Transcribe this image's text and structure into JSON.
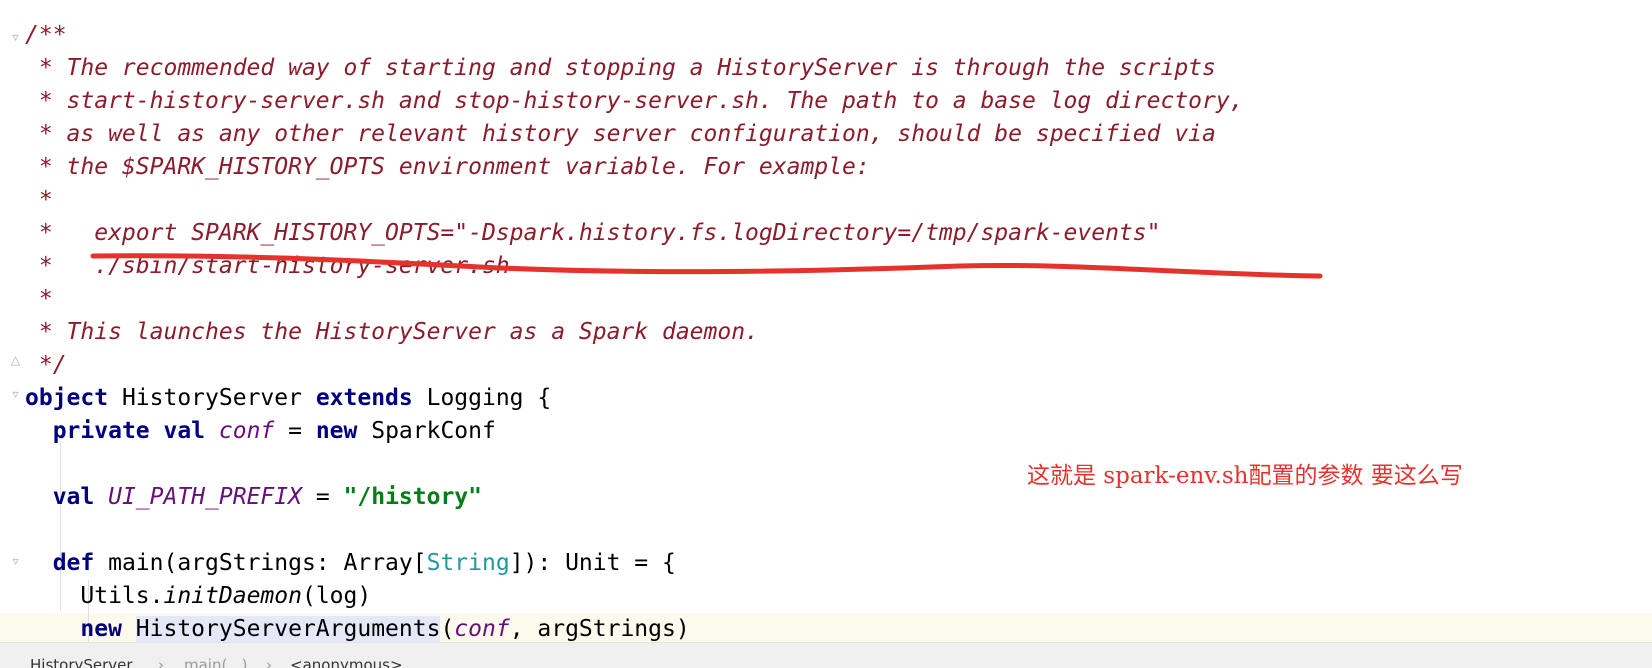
{
  "editor": {
    "lines": [
      {
        "tokens": [
          {
            "t": "/**",
            "c": "comment"
          }
        ]
      },
      {
        "tokens": [
          {
            "t": " * The recommended way of starting and stopping a HistoryServer is through the scripts",
            "c": "comment"
          }
        ]
      },
      {
        "tokens": [
          {
            "t": " * start-history-server.sh and stop-history-server.sh. The path to a base log directory,",
            "c": "comment"
          }
        ]
      },
      {
        "tokens": [
          {
            "t": " * as well as any other relevant history server configuration, should be specified via",
            "c": "comment"
          }
        ]
      },
      {
        "tokens": [
          {
            "t": " * the $SPARK_HISTORY_OPTS environment variable. For example:",
            "c": "comment"
          }
        ]
      },
      {
        "tokens": [
          {
            "t": " *",
            "c": "comment"
          }
        ]
      },
      {
        "tokens": [
          {
            "t": " *   export SPARK_HISTORY_OPTS=\"-Dspark.history.fs.logDirectory=/tmp/spark-events\"",
            "c": "comment"
          }
        ]
      },
      {
        "tokens": [
          {
            "t": " *   ./sbin/start-history-server.sh",
            "c": "comment"
          }
        ]
      },
      {
        "tokens": [
          {
            "t": " *",
            "c": "comment"
          }
        ]
      },
      {
        "tokens": [
          {
            "t": " * This launches the HistoryServer as a Spark daemon.",
            "c": "comment"
          }
        ]
      },
      {
        "tokens": [
          {
            "t": " */",
            "c": "comment"
          }
        ]
      },
      {
        "tokens": [
          {
            "t": "object",
            "c": "kw"
          },
          {
            "t": " HistoryServer ",
            "c": "plain"
          },
          {
            "t": "extends",
            "c": "kw"
          },
          {
            "t": " Logging {",
            "c": "plain"
          }
        ]
      },
      {
        "tokens": [
          {
            "t": "  ",
            "c": "plain"
          },
          {
            "t": "private val",
            "c": "kw"
          },
          {
            "t": " ",
            "c": "plain"
          },
          {
            "t": "conf",
            "c": "field"
          },
          {
            "t": " = ",
            "c": "plain"
          },
          {
            "t": "new",
            "c": "kw"
          },
          {
            "t": " SparkConf",
            "c": "plain"
          }
        ]
      },
      {
        "tokens": []
      },
      {
        "tokens": [
          {
            "t": "  ",
            "c": "plain"
          },
          {
            "t": "val",
            "c": "kw"
          },
          {
            "t": " ",
            "c": "plain"
          },
          {
            "t": "UI_PATH_PREFIX",
            "c": "field"
          },
          {
            "t": " = ",
            "c": "plain"
          },
          {
            "t": "\"/history\"",
            "c": "str"
          }
        ]
      },
      {
        "tokens": []
      },
      {
        "tokens": [
          {
            "t": "  ",
            "c": "plain"
          },
          {
            "t": "def",
            "c": "kw"
          },
          {
            "t": " main(argStrings: Array[",
            "c": "plain"
          },
          {
            "t": "String",
            "c": "tparam"
          },
          {
            "t": "]): Unit = {",
            "c": "plain"
          }
        ]
      },
      {
        "tokens": [
          {
            "t": "    Utils.",
            "c": "plain"
          },
          {
            "t": "initDaemon",
            "c": "static-call"
          },
          {
            "t": "(log)",
            "c": "plain"
          }
        ]
      },
      {
        "tokens": [
          {
            "t": "    ",
            "c": "plain"
          },
          {
            "t": "new",
            "c": "kw"
          },
          {
            "t": " ",
            "c": "plain"
          },
          {
            "t": "HistoryServerArguments",
            "c": "usage-highlight"
          },
          {
            "t": "(",
            "c": "plain"
          },
          {
            "t": "conf",
            "c": "field"
          },
          {
            "t": ", argStrings)",
            "c": "plain"
          }
        ]
      }
    ]
  },
  "annotation": {
    "text": "这就是 spark-env.sh配置的参数 要这么写"
  },
  "breadcrumb": {
    "items": [
      "HistoryServer",
      "main(...)",
      "<anonymous>"
    ],
    "separator": "›"
  },
  "colors": {
    "comment": "#8c1b2b",
    "keyword": "#000080",
    "field": "#660e7a",
    "string": "#067d17",
    "type_param": "#20999d",
    "annotation": "#e5322d",
    "current_line": "#fcfaed",
    "usage_highlight": "#e5e8f8"
  },
  "icons": [
    "fold-start-icon",
    "fold-end-icon"
  ]
}
